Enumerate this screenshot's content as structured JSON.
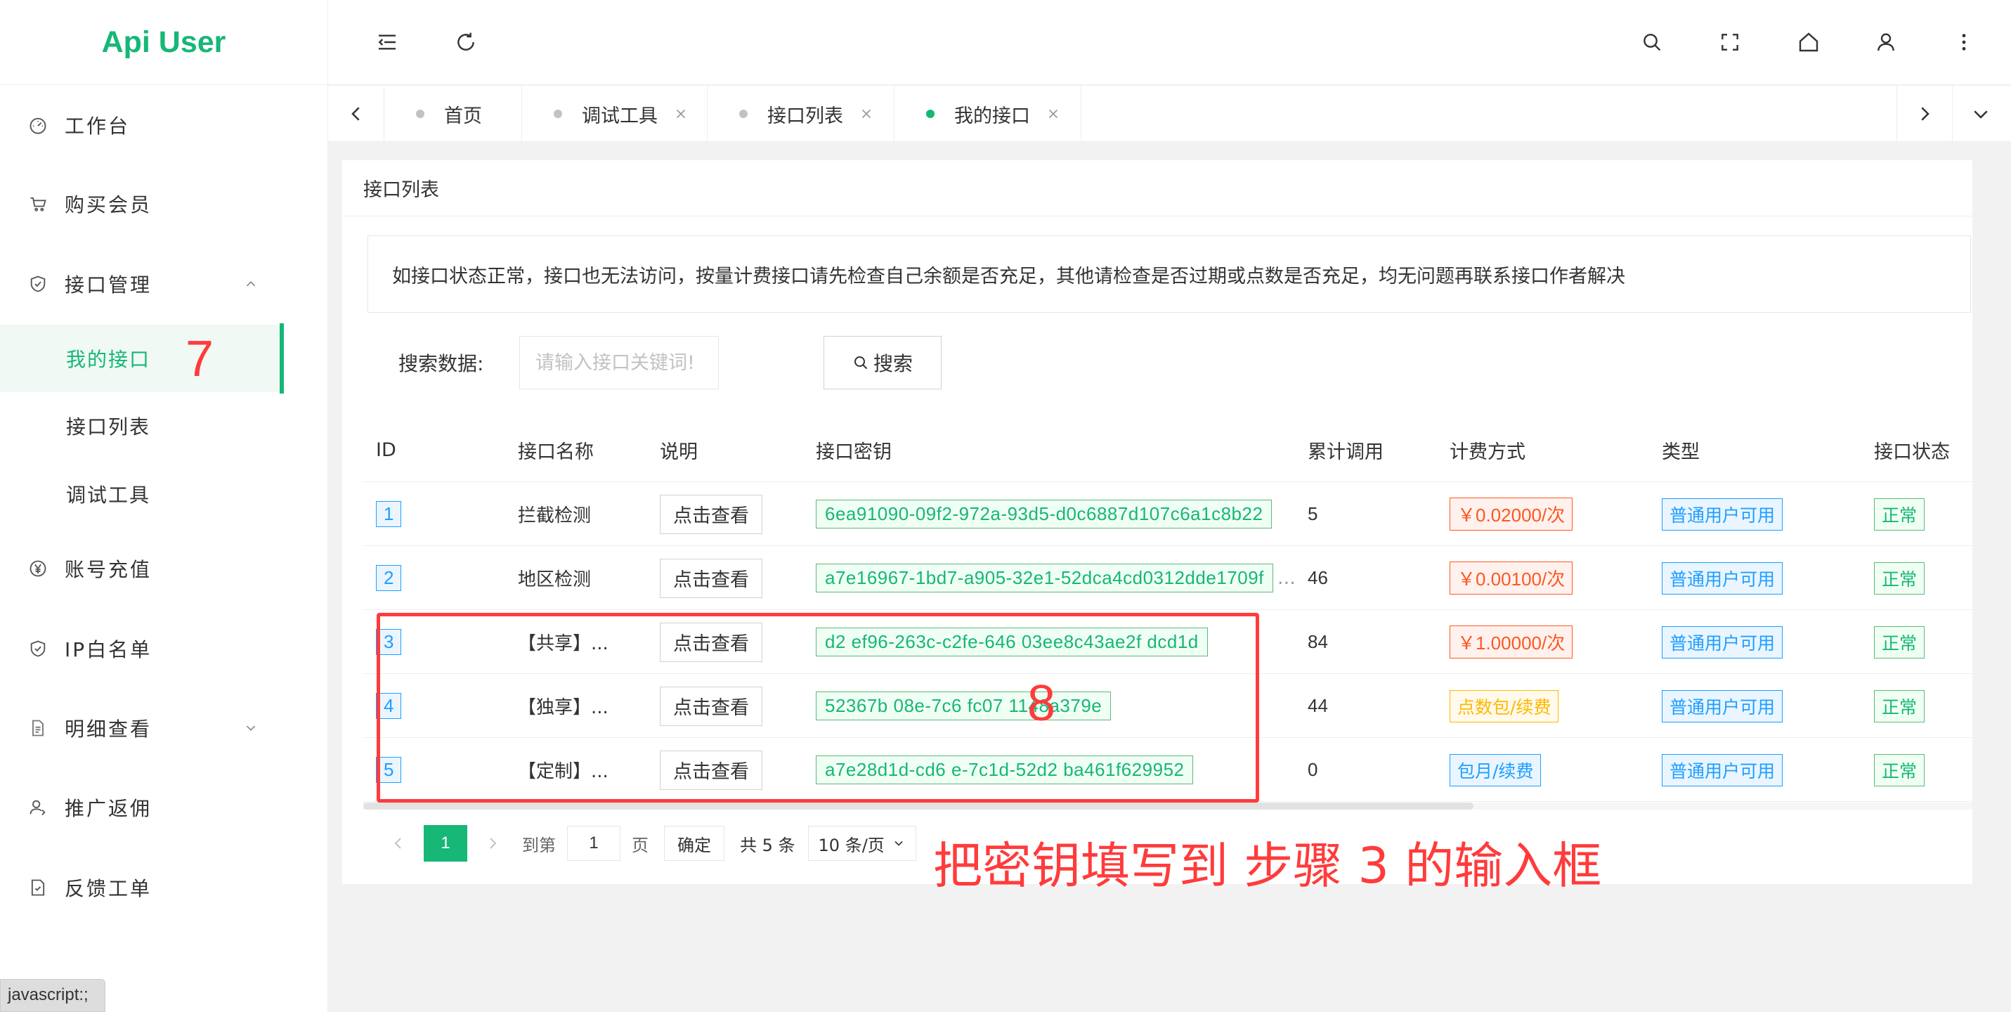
{
  "app": {
    "title": "Api User"
  },
  "sidebar": {
    "items": [
      {
        "label": "工作台",
        "icon": "dashboard-icon"
      },
      {
        "label": "购买会员",
        "icon": "cart-icon"
      },
      {
        "label": "接口管理",
        "icon": "shield-check-icon",
        "expanded": true,
        "children": [
          {
            "label": "我的接口",
            "active": true
          },
          {
            "label": "接口列表"
          },
          {
            "label": "调试工具"
          }
        ]
      },
      {
        "label": "账号充值",
        "icon": "yen-icon"
      },
      {
        "label": "IP白名单",
        "icon": "shield-check-icon"
      },
      {
        "label": "明细查看",
        "icon": "document-icon",
        "expanded": false
      },
      {
        "label": "推广返佣",
        "icon": "user-share-icon"
      },
      {
        "label": "反馈工单",
        "icon": "feedback-icon"
      }
    ]
  },
  "header": {
    "icons": [
      "menu-collapse-icon",
      "refresh-icon",
      "search-icon",
      "fullscreen-icon",
      "home-icon",
      "user-icon",
      "more-vertical-icon"
    ]
  },
  "tabs": [
    {
      "label": "首页",
      "closable": false
    },
    {
      "label": "调试工具",
      "closable": true
    },
    {
      "label": "接口列表",
      "closable": true
    },
    {
      "label": "我的接口",
      "closable": true,
      "active": true
    }
  ],
  "card": {
    "title": "接口列表",
    "notice": "如接口状态正常，接口也无法访问，按量计费接口请先检查自己余额是否充足，其他请检查是否过期或点数是否充足，均无问题再联系接口作者解决",
    "search": {
      "label": "搜索数据:",
      "placeholder": "请输入接口关键词!",
      "button": "搜索"
    }
  },
  "table": {
    "columns": [
      "ID",
      "接口名称",
      "说明",
      "接口密钥",
      "累计调用",
      "计费方式",
      "类型",
      "接口状态"
    ],
    "rows": [
      {
        "id": "1",
        "name": "拦截检测",
        "desc": "点击查看",
        "key": "6ea91090-09f2-972a-93d5-d0c6887d107c6a1c8b22",
        "calls": "5",
        "billing": "￥0.02000/次",
        "billing_style": "red",
        "type": "普通用户可用",
        "status": "正常"
      },
      {
        "id": "2",
        "name": "地区检测",
        "desc": "点击查看",
        "key": "a7e16967-1bd7-a905-32e1-52dca4cd0312dde1709f",
        "calls": "46",
        "billing": "￥0.00100/次",
        "billing_style": "red",
        "type": "普通用户可用",
        "status": "正常"
      },
      {
        "id": "3",
        "name": "【共享】...",
        "desc": "点击查看",
        "key": "d2 ef96-263c-c2fe-646 03ee8c43ae2f dcd1d",
        "calls": "84",
        "billing": "￥1.00000/次",
        "billing_style": "red",
        "type": "普通用户可用",
        "status": "正常"
      },
      {
        "id": "4",
        "name": "【独享】...",
        "desc": "点击查看",
        "key": "52367b 08e-7c6 fc07 1148a379e",
        "calls": "44",
        "billing": "点数包/续费",
        "billing_style": "orange",
        "type": "普通用户可用",
        "status": "正常"
      },
      {
        "id": "5",
        "name": "【定制】...",
        "desc": "点击查看",
        "key": "a7e28d1d-cd6 e-7c1d-52d2 ba461f629952",
        "calls": "0",
        "billing": "包月/续费",
        "billing_style": "blue",
        "type": "普通用户可用",
        "status": "正常"
      }
    ]
  },
  "pagination": {
    "current": "1",
    "goto_label": "到第",
    "goto_value": "1",
    "page_label": "页",
    "confirm": "确定",
    "total": "共 5 条",
    "page_size": "10 条/页"
  },
  "annotations": {
    "step7": "7",
    "step8": "8",
    "instruction": "把密钥填写到 步骤 3 的输入框"
  },
  "statusbar": {
    "url": "javascript:;"
  },
  "colors": {
    "accent": "#16b777",
    "annotation": "#ff3b3b",
    "link_blue": "#1e9fff",
    "danger": "#ff5722",
    "warn": "#ffb800"
  }
}
